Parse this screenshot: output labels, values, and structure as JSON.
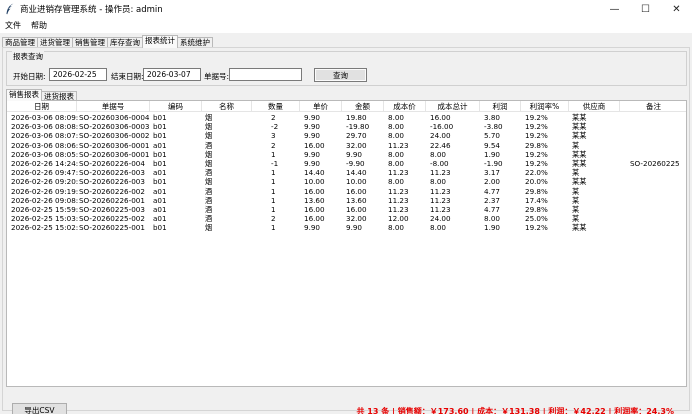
{
  "window": {
    "title": "商业进销存管理系统 - 操作员: admin",
    "minimize": "—",
    "maximize": "☐",
    "close": "✕"
  },
  "menu": [
    "文件",
    "帮助"
  ],
  "main_tabs": [
    "商品管理",
    "进货管理",
    "销售管理",
    "库存查询",
    "报表统计",
    "系统维护"
  ],
  "main_tab_active": 4,
  "query": {
    "group_title": "报表查询",
    "start_label": "开始日期:",
    "start_value": "2026-02-25",
    "end_label": "结束日期:",
    "end_value": "2026-03-07",
    "order_label": "单据号:",
    "order_value": "",
    "button": "查询"
  },
  "sub_tabs": [
    "销售报表",
    "进货报表"
  ],
  "sub_tab_active": 0,
  "columns": [
    "日期",
    "单据号",
    "编码",
    "名称",
    "数量",
    "单价",
    "金额",
    "成本价",
    "成本总计",
    "利润",
    "利润率%",
    "供应商",
    "备注"
  ],
  "rows": [
    [
      "2026-03-06 08:09:",
      "SO-20260306-0004",
      "b01",
      "烟",
      "2",
      "9.90",
      "19.80",
      "8.00",
      "16.00",
      "3.80",
      "19.2%",
      "某某",
      ""
    ],
    [
      "2026-03-06 08:08:",
      "SO-20260306-0003",
      "b01",
      "烟",
      "-2",
      "9.90",
      "-19.80",
      "8.00",
      "-16.00",
      "-3.80",
      "19.2%",
      "某某",
      ""
    ],
    [
      "2026-03-06 08:07:",
      "SO-20260306-0002",
      "b01",
      "烟",
      "3",
      "9.90",
      "29.70",
      "8.00",
      "24.00",
      "5.70",
      "19.2%",
      "某某",
      ""
    ],
    [
      "2026-03-06 08:06:",
      "SO-20260306-0001",
      "a01",
      "酒",
      "2",
      "16.00",
      "32.00",
      "11.23",
      "22.46",
      "9.54",
      "29.8%",
      "某",
      ""
    ],
    [
      "2026-03-06 08:05:",
      "SO-20260306-0001",
      "b01",
      "烟",
      "1",
      "9.90",
      "9.90",
      "8.00",
      "8.00",
      "1.90",
      "19.2%",
      "某某",
      ""
    ],
    [
      "2026-02-26 14:24:",
      "SO-20260226-004",
      "b01",
      "烟",
      "-1",
      "9.90",
      "-9.90",
      "8.00",
      "-8.00",
      "-1.90",
      "19.2%",
      "某某",
      "SO-20260225"
    ],
    [
      "2026-02-26 09:47:",
      "SO-20260226-003",
      "a01",
      "酒",
      "1",
      "14.40",
      "14.40",
      "11.23",
      "11.23",
      "3.17",
      "22.0%",
      "某",
      ""
    ],
    [
      "2026-02-26 09:20:",
      "SO-20260226-003",
      "b01",
      "烟",
      "1",
      "10.00",
      "10.00",
      "8.00",
      "8.00",
      "2.00",
      "20.0%",
      "某某",
      ""
    ],
    [
      "2026-02-26 09:19:",
      "SO-20260226-002",
      "a01",
      "酒",
      "1",
      "16.00",
      "16.00",
      "11.23",
      "11.23",
      "4.77",
      "29.8%",
      "某",
      ""
    ],
    [
      "2026-02-26 09:08:",
      "SO-20260226-001",
      "a01",
      "酒",
      "1",
      "13.60",
      "13.60",
      "11.23",
      "11.23",
      "2.37",
      "17.4%",
      "某",
      ""
    ],
    [
      "2026-02-25 15:59:",
      "SO-20260225-003",
      "a01",
      "酒",
      "1",
      "16.00",
      "16.00",
      "11.23",
      "11.23",
      "4.77",
      "29.8%",
      "某",
      ""
    ],
    [
      "2026-02-25 15:03:",
      "SO-20260225-002",
      "a01",
      "酒",
      "2",
      "16.00",
      "32.00",
      "12.00",
      "24.00",
      "8.00",
      "25.0%",
      "某",
      ""
    ],
    [
      "2026-02-25 15:02:",
      "SO-20260225-001",
      "b01",
      "烟",
      "1",
      "9.90",
      "9.90",
      "8.00",
      "8.00",
      "1.90",
      "19.2%",
      "某某",
      ""
    ]
  ],
  "export_button": "导出CSV",
  "summary": "共 13 条 | 销售额：￥173.60 | 成本：￥131.38 | 利润：￥42.22 | 利润率：24.3%",
  "colors": {
    "accent_red": "#e60000",
    "panel_bg": "#f0f0f0"
  }
}
